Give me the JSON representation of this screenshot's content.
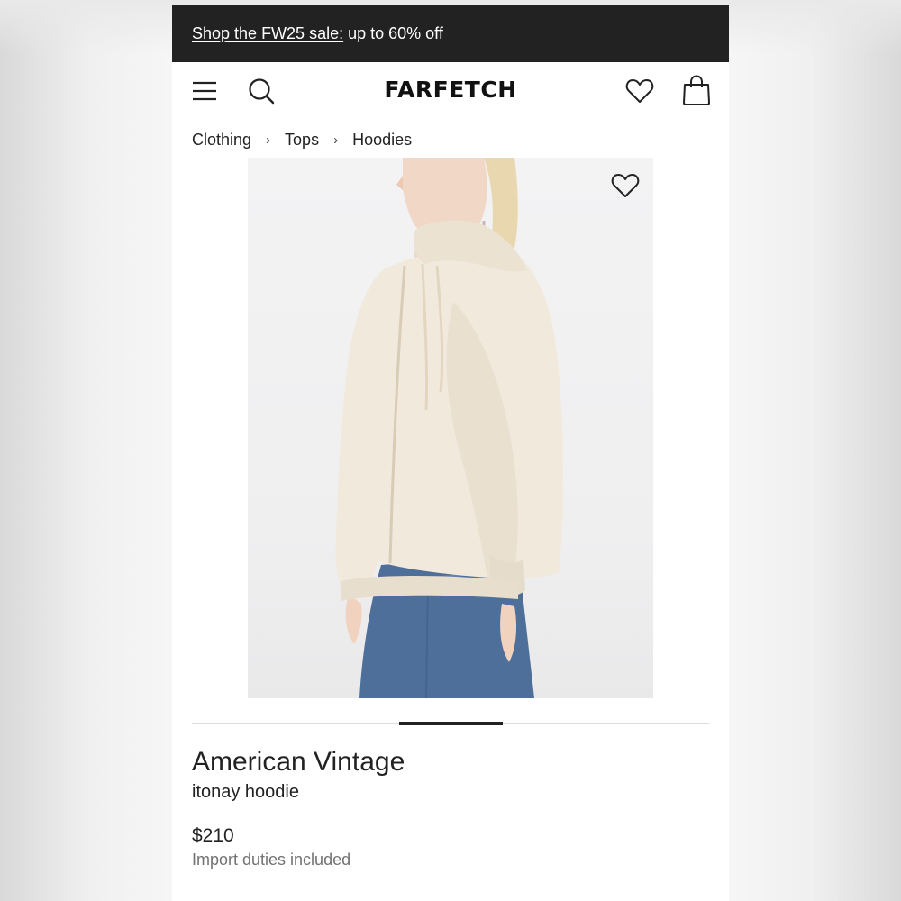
{
  "promo": {
    "link_text": "Shop the FW25 sale:",
    "rest_text": "up to 60% off"
  },
  "header": {
    "logo": "FARFETCH",
    "icons": [
      "menu-icon",
      "search-icon",
      "heart-icon",
      "shopping-bag-icon"
    ]
  },
  "breadcrumb": {
    "items": [
      "Clothing",
      "Tops",
      "Hoodies"
    ],
    "separator": "›"
  },
  "carousel": {
    "active_index": 2,
    "visible_fraction": 0.2
  },
  "product": {
    "brand": "American Vintage",
    "name": "itonay hoodie",
    "price": "$210",
    "duties_note": "Import duties included"
  },
  "colors": {
    "promo_bg": "#222222",
    "text": "#222222",
    "muted": "#727272",
    "hoodie": "#f1e9dc",
    "denim": "#4d6f99"
  }
}
